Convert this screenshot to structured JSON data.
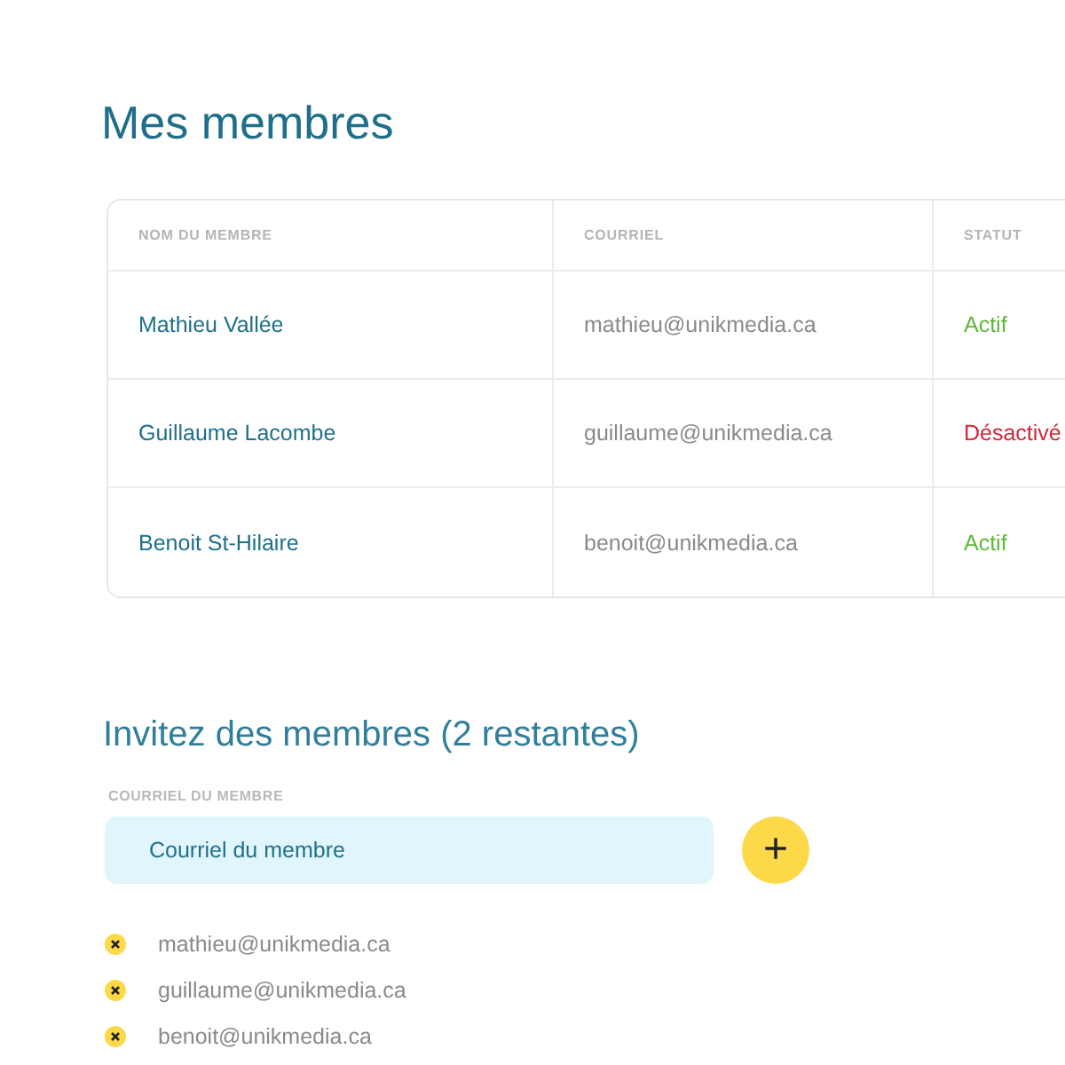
{
  "title": "Mes membres",
  "table": {
    "columns": [
      "NOM DU MEMBRE",
      "COURRIEL",
      "STATUT"
    ],
    "rows": [
      {
        "name": "Mathieu Vallée",
        "email": "mathieu@unikmedia.ca",
        "status": "Actif",
        "active": true
      },
      {
        "name": "Guillaume Lacombe",
        "email": "guillaume@unikmedia.ca",
        "status": "Désactivé",
        "active": false
      },
      {
        "name": "Benoit St-Hilaire",
        "email": "benoit@unikmedia.ca",
        "status": "Actif",
        "active": true
      }
    ]
  },
  "invite": {
    "title": "Invitez des membres (2 restantes)",
    "field_label": "COURRIEL DU MEMBRE",
    "placeholder": "Courriel du membre",
    "add_button": "+",
    "invited": [
      "mathieu@unikmedia.ca",
      "guillaume@unikmedia.ca",
      "benoit@unikmedia.ca"
    ]
  }
}
